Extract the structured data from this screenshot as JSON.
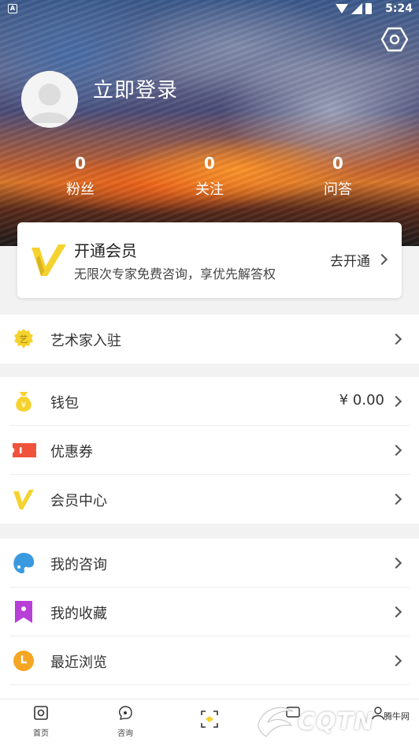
{
  "status_bar": {
    "time": "5:24",
    "notification_icon": "A"
  },
  "profile": {
    "login_label": "立即登录"
  },
  "stats": [
    {
      "count": "0",
      "label": "粉丝"
    },
    {
      "count": "0",
      "label": "关注"
    },
    {
      "count": "0",
      "label": "问答"
    }
  ],
  "vip_card": {
    "title": "开通会员",
    "subtitle": "无限次专家免费咨询，享优先解答权",
    "action": "去开通"
  },
  "groups": [
    {
      "items": [
        {
          "icon": "artist-badge-icon",
          "label": "艺术家入驻"
        }
      ]
    },
    {
      "items": [
        {
          "icon": "money-bag-icon",
          "label": "钱包",
          "value": "¥ 0.00"
        },
        {
          "icon": "coupon-icon",
          "label": "优惠券"
        },
        {
          "icon": "vip-v-icon",
          "label": "会员中心"
        }
      ]
    },
    {
      "items": [
        {
          "icon": "palette-icon",
          "label": "我的咨询"
        },
        {
          "icon": "bookmark-icon",
          "label": "我的收藏"
        },
        {
          "icon": "clock-icon",
          "label": "最近浏览"
        }
      ]
    }
  ],
  "bottom_nav": [
    {
      "icon": "home-icon",
      "label": "首页"
    },
    {
      "icon": "consult-icon",
      "label": "咨询"
    },
    {
      "icon": "scan-icon",
      "label": ""
    },
    {
      "icon": "message-icon",
      "label": ""
    },
    {
      "icon": "profile-icon",
      "label": ""
    }
  ],
  "watermark": {
    "text": "CQTN",
    "small": "腾牛网"
  },
  "colors": {
    "accent_yellow": "#f5d22e",
    "coupon_red": "#f0533b",
    "bookmark_purple": "#b73ed6",
    "palette_blue": "#3a9ae0",
    "clock_orange": "#f5a623"
  }
}
